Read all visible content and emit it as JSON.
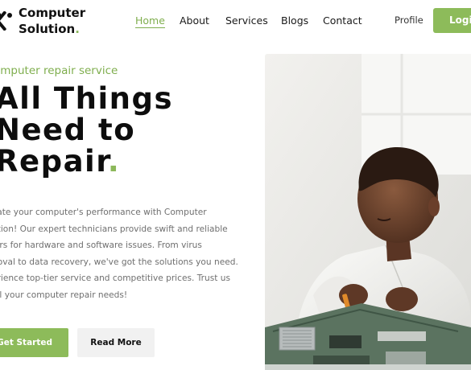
{
  "brand": {
    "name_line1": "Computer",
    "name_line2": "Solution",
    "dot": ".",
    "logo_icon": "wrench-screwdriver-icon",
    "accent_color": "#8dbb5a"
  },
  "nav": {
    "items": [
      {
        "label": "Home",
        "active": true
      },
      {
        "label": "About",
        "active": false
      },
      {
        "label": "Services",
        "active": false
      },
      {
        "label": "Blogs",
        "active": false
      },
      {
        "label": "Contact",
        "active": false
      }
    ],
    "profile_label": "Profile",
    "login_label": "Login"
  },
  "hero": {
    "tagline": "omputer repair service",
    "headline_lines": [
      "All Things",
      "Need to",
      "Repair"
    ],
    "headline_dot": ".",
    "description_lines": [
      "vate your computer's performance with Computer",
      "ution! Our expert technicians provide swift and reliable",
      "airs for hardware and software issues. From virus",
      "noval to data recovery, we've got the solutions you need.",
      "erience top-tier service and competitive prices. Trust us",
      "all your computer repair needs!"
    ],
    "primary_button": "Get Started",
    "secondary_button": "Read More",
    "image_subject": "technician-repairing-motherboard-photo"
  }
}
